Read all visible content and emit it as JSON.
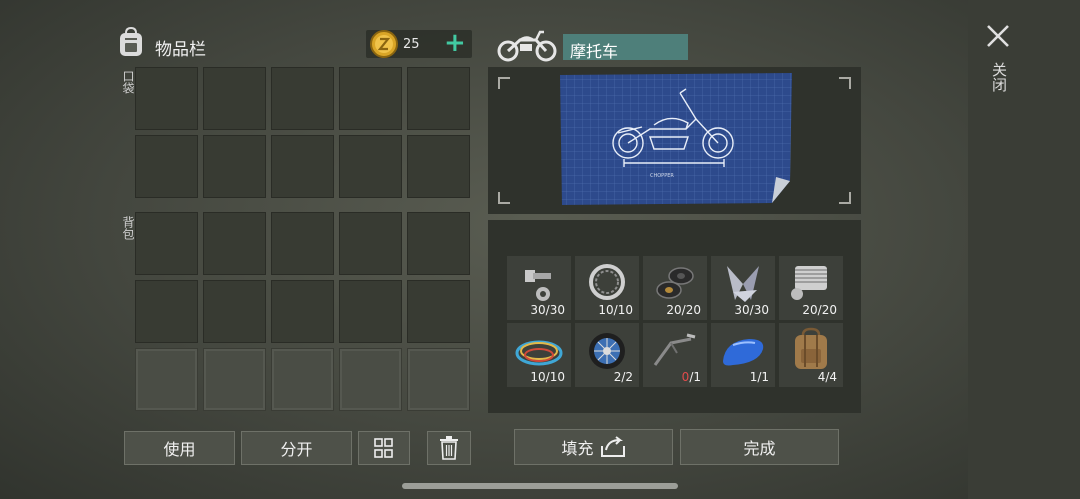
{
  "inventory": {
    "title": "物品栏",
    "pocket_label": "口袋",
    "backpack_label": "背包",
    "coins": "25",
    "add_symbol": "+"
  },
  "craft": {
    "item_name": "摩托车",
    "blueprint_caption": "CHOPPER",
    "materials": [
      {
        "icon": "bolt-icon",
        "count": "30/30"
      },
      {
        "icon": "bearing-ring-icon",
        "count": "10/10"
      },
      {
        "icon": "washers-icon",
        "count": "20/20"
      },
      {
        "icon": "steel-parts-icon",
        "count": "30/30"
      },
      {
        "icon": "engine-block-icon",
        "count": "20/20"
      },
      {
        "icon": "wire-coil-icon",
        "count": "10/10"
      },
      {
        "icon": "motorcycle-wheel-icon",
        "count": "2/2"
      },
      {
        "icon": "handlebar-icon",
        "count_have": "0",
        "count_need": "/1"
      },
      {
        "icon": "fuel-tank-icon",
        "count": "1/1"
      },
      {
        "icon": "leather-backpack-icon",
        "count": "4/4"
      }
    ]
  },
  "buttons": {
    "use": "使用",
    "split": "分开",
    "fill": "填充",
    "done": "完成"
  },
  "window": {
    "close_label": "关闭"
  },
  "colors": {
    "accent_teal": "#42c9a2",
    "title_box": "#4e7f7a",
    "missing_red": "#e14b4b",
    "coin_gold": "#d9a526"
  }
}
